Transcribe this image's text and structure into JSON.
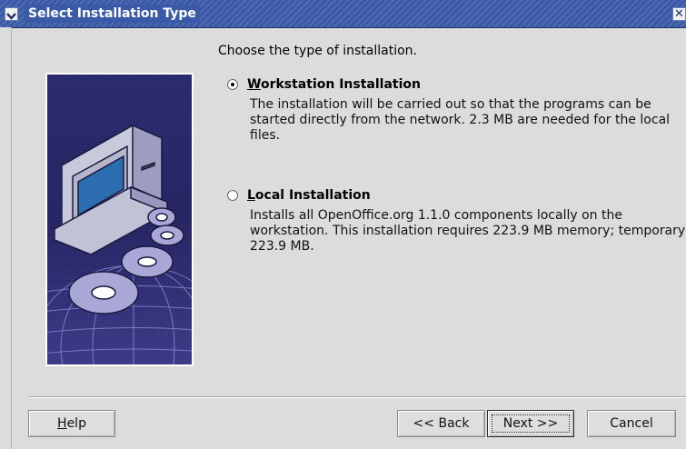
{
  "window": {
    "title": "Select Installation Type"
  },
  "main": {
    "prompt": "Choose the type of installation."
  },
  "options": [
    {
      "label_key": "W",
      "label_rest": "orkstation Installation",
      "selected": true,
      "description": "The installation will be carried out so that the programs can be started directly from the network. 2.3 MB are needed for the local files."
    },
    {
      "label_key": "L",
      "label_rest": "ocal Installation",
      "selected": false,
      "description": "Installs all OpenOffice.org 1.1.0 components locally on the workstation. This installation requires 223.9 MB memory; temporary 223.9 MB."
    }
  ],
  "buttons": {
    "help_key": "H",
    "help_rest": "elp",
    "back": "<< Back",
    "next": "Next >>",
    "cancel": "Cancel"
  },
  "icons": {
    "menu": "chevron-down-icon",
    "close": "close-icon",
    "illustration": "computer-discs-globe-illustration"
  },
  "colors": {
    "titlebar": "#3a5aa8",
    "background": "#dcdcdc",
    "illustration_bg": "#1f1d5a"
  }
}
